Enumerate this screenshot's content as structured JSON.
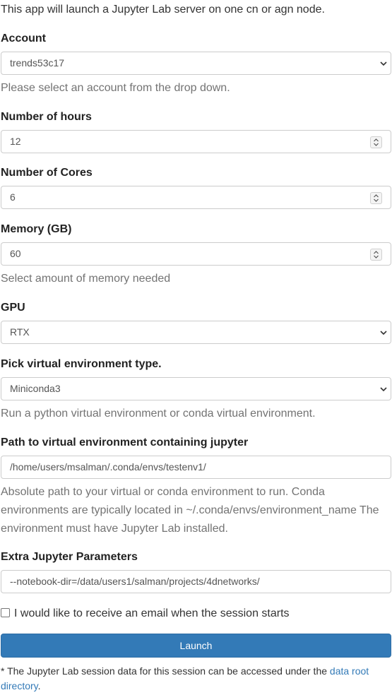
{
  "intro": "This app will launch a Jupyter Lab server on one cn or agn node.",
  "account": {
    "label": "Account",
    "value": "trends53c17",
    "help": "Please select an account from the drop down."
  },
  "hours": {
    "label": "Number of hours",
    "value": "12"
  },
  "cores": {
    "label": "Number of Cores",
    "value": "6"
  },
  "memory": {
    "label": "Memory (GB)",
    "value": "60",
    "help": "Select amount of memory needed"
  },
  "gpu": {
    "label": "GPU",
    "value": "RTX"
  },
  "venv_type": {
    "label": "Pick virtual environment type.",
    "value": "Miniconda3",
    "help": "Run a python virtual environment or conda virtual environment."
  },
  "venv_path": {
    "label": "Path to virtual environment containing jupyter",
    "value": "/home/users/msalman/.conda/envs/testenv1/",
    "help": "Absolute path to your virtual or conda environment to run. Conda environments are typically located in ~/.conda/envs/environment_name The environment must have Jupyter Lab installed."
  },
  "extra_params": {
    "label": "Extra Jupyter Parameters",
    "value": "--notebook-dir=/data/users1/salman/projects/4dnetworks/"
  },
  "email_checkbox": {
    "label": "I would like to receive an email when the session starts",
    "checked": false
  },
  "launch_button": "Launch",
  "footnote": {
    "text": "* The Jupyter Lab session data for this session can be accessed under the ",
    "link": "data root directory",
    "suffix": "."
  },
  "colors": {
    "primary": "#337ab7",
    "help_text": "#737373",
    "border": "#cccccc"
  },
  "icons": {
    "select": "chevron-down-icon",
    "number": "spinner-icon"
  }
}
